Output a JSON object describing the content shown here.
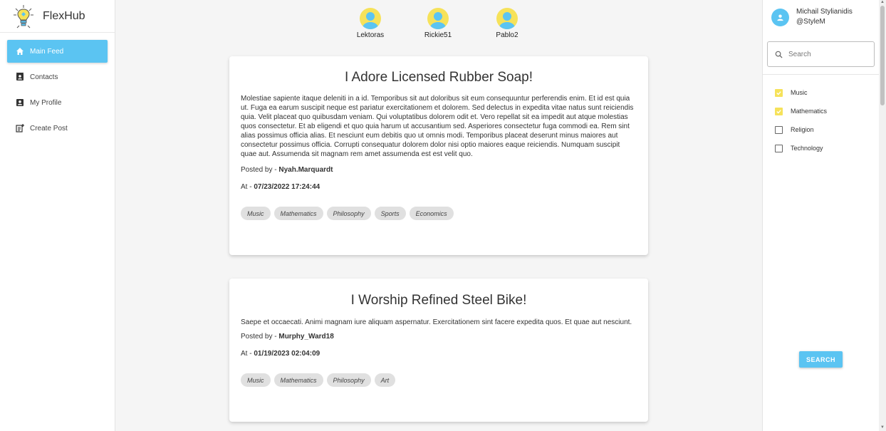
{
  "app": {
    "name": "FlexHub"
  },
  "nav": [
    {
      "label": "Main Feed",
      "icon": "home-icon",
      "active": true
    },
    {
      "label": "Contacts",
      "icon": "contacts-icon",
      "active": false
    },
    {
      "label": "My Profile",
      "icon": "profile-icon",
      "active": false
    },
    {
      "label": "Create Post",
      "icon": "create-post-icon",
      "active": false
    }
  ],
  "top_users": [
    {
      "name": "Lektoras"
    },
    {
      "name": "Rickie51"
    },
    {
      "name": "Pablo2"
    }
  ],
  "posts": [
    {
      "title": "I Adore Licensed Rubber Soap!",
      "body": "Molestiae sapiente itaque deleniti in a id. Temporibus sit aut doloribus sit eum consequuntur perferendis enim. Et id est quia ut. Fuga ea earum suscipit neque est pariatur exercitationem et dolorem. Sed delectus in expedita vitae natus sunt reiciendis quia. Velit placeat quo quibusdam veniam. Qui voluptatibus dolorem odit et. Vero repellat sit ea impedit aut atque molestias quos consectetur. Et ab eligendi et quo quia harum ut accusantium sed. Asperiores consectetur fuga commodi ea. Rem sint alias possimus officia alias. Et nesciunt eum debitis quo ut omnis modi. Temporibus placeat deserunt minus maiores aut consectetur possimus officia. Corrupti consequatur dolorem dolor nisi optio maiores eaque reiciendis. Numquam suscipit quae aut. Assumenda sit magnam rem amet assumenda est est velit quo.",
      "posted_by_label": "Posted by - ",
      "author": "Nyah.Marquardt",
      "at_label": "At - ",
      "timestamp": "07/23/2022 17:24:44",
      "tags": [
        "Music",
        "Mathematics",
        "Philosophy",
        "Sports",
        "Economics"
      ]
    },
    {
      "title": "I Worship Refined Steel Bike!",
      "body": "Saepe et occaecati. Animi magnam iure aliquam aspernatur. Exercitationem sint facere expedita quos. Et quae aut nesciunt.",
      "posted_by_label": "Posted by - ",
      "author": "Murphy_Ward18",
      "at_label": "At - ",
      "timestamp": "01/19/2023 02:04:09",
      "tags": [
        "Music",
        "Mathematics",
        "Philosophy",
        "Art"
      ]
    }
  ],
  "profile": {
    "name": "Michail Stylianidis",
    "handle": "@StyleM"
  },
  "search": {
    "placeholder": "Search",
    "value": ""
  },
  "filters": [
    {
      "label": "Music",
      "checked": true
    },
    {
      "label": "Mathematics",
      "checked": true
    },
    {
      "label": "Religion",
      "checked": false
    },
    {
      "label": "Technology",
      "checked": false
    }
  ],
  "search_button": {
    "label": "SEARCH"
  },
  "colors": {
    "accent": "#5bc4f2",
    "highlight": "#f6e25a"
  }
}
